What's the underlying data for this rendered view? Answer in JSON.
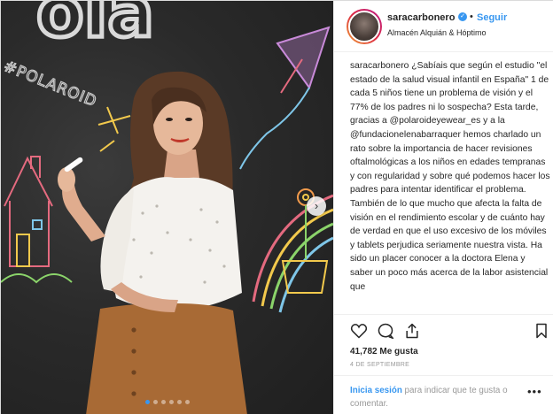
{
  "photo": {
    "wall_text_top": "ola",
    "wall_text_side": "#POLAROID",
    "carousel_next_glyph": "›",
    "dots": [
      true,
      false,
      false,
      false,
      false,
      false
    ],
    "carousel_index": 1,
    "carousel_total": 6
  },
  "header": {
    "username": "saracarbonero",
    "verified_glyph": "✓",
    "separator": "•",
    "follow_label": "Seguir",
    "location": "Almacén Alquián & Hóptimo"
  },
  "caption": {
    "username": "saracarbonero",
    "text": "¿Sabíais que según el estudio \"el estado de la salud visual infantil en España\" 1 de cada 5 niños tiene un problema de visión y el 77% de los padres ni lo sospecha? Esta tarde, gracias a @polaroideyewear_es y a la @fundacionelenabarraquer hemos charlado un rato sobre la importancia de hacer revisiones oftalmológicas a los niños en edades tempranas y con regularidad y sobre qué podemos hacer los padres para intentar identificar el problema. También de lo que mucho que afecta la falta de visión en el rendimiento escolar y de cuánto hay de verdad en que el uso excesivo de los móviles y tablets perjudica seriamente nuestra vista. Ha sido un placer conocer a la doctora Elena y saber un poco más acerca de la labor asistencial que"
  },
  "actions": {
    "like_icon": "heart-icon",
    "comment_icon": "speech-bubble-icon",
    "share_icon": "share-icon",
    "save_icon": "bookmark-icon"
  },
  "likes": "41,782 Me gusta",
  "date": "4 DE SEPTIEMBRE",
  "comment_box": {
    "login_label": "Inicia sesión",
    "rest": " para indicar que te gusta o comentar.",
    "more_glyph": "•••"
  },
  "colors": {
    "accent": "#3897f0",
    "text": "#262626",
    "muted": "#999999",
    "border": "#efefef"
  }
}
